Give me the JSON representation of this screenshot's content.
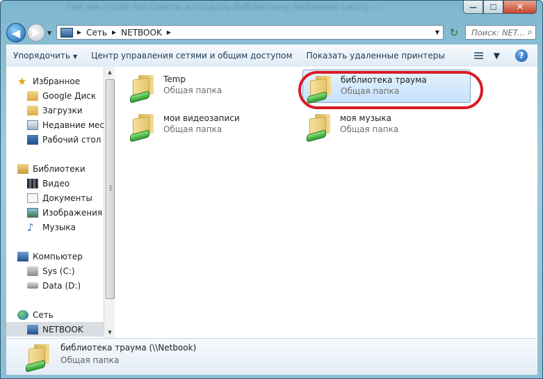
{
  "window": {
    "title_blurred": "Так же стоит поставить и создать библиотеку любимым смотр ...",
    "caption": {
      "minimize": "—",
      "maximize": "☐",
      "close": "✕"
    }
  },
  "address": {
    "crumbs": [
      "Сеть",
      "NETBOOK"
    ]
  },
  "search": {
    "placeholder": "Поиск: NET..."
  },
  "toolbar": {
    "organize": "Упорядочить",
    "network_center": "Центр управления сетями и общим доступом",
    "show_printers": "Показать удаленные принтеры",
    "help": "?"
  },
  "sidebar": {
    "favorites": {
      "label": "Избранное",
      "items": [
        "Google Диск",
        "Загрузки",
        "Недавние места",
        "Рабочий стол"
      ]
    },
    "libraries": {
      "label": "Библиотеки",
      "items": [
        "Видео",
        "Документы",
        "Изображения",
        "Музыка"
      ]
    },
    "computer": {
      "label": "Компьютер",
      "items": [
        "Sys (C:)",
        "Data (D:)"
      ]
    },
    "network": {
      "label": "Сеть",
      "items": [
        "NETBOOK"
      ]
    }
  },
  "items": [
    {
      "name": "Temp",
      "type": "Общая папка"
    },
    {
      "name": "библиотека траума",
      "type": "Общая папка",
      "selected": true
    },
    {
      "name": "мои видеозаписи",
      "type": "Общая папка"
    },
    {
      "name": "моя музыка",
      "type": "Общая папка"
    }
  ],
  "details": {
    "name": "библиотека траума (\\\\Netbook)",
    "type": "Общая папка"
  },
  "colors": {
    "highlight": "#d81b25",
    "selection": "#c4e1fb"
  }
}
